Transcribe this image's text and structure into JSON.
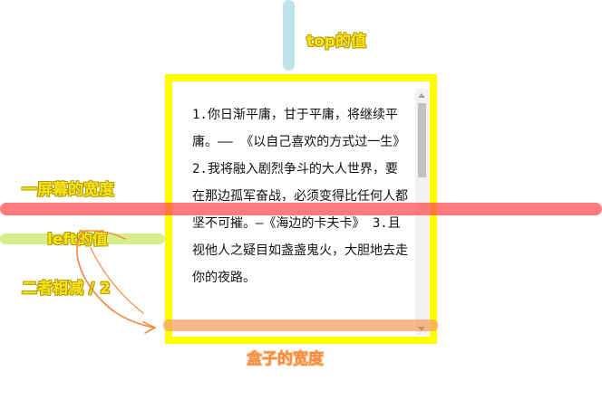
{
  "annotations": {
    "top_value": "top的值",
    "screen_width": "一屏幕的宽度",
    "left_value": "left的值",
    "difference_half": "二者相减 / 2",
    "box_width": "盒子的宽度"
  },
  "box": {
    "text": "1.你日渐平庸，甘于平庸，将继续平庸。—— 《以自己喜欢的方式过一生》 2.我将融入剧烈争斗的大人世界，要在那边孤军奋战，必须变得比任何人都坚不可摧。—《海边的卡夫卡》 3.且视他人之疑目如盏盏鬼火，大胆地去走你的夜路。"
  },
  "colors": {
    "box_border": "#ffff00",
    "top_bar": "#bfe3ea",
    "screen_bar": "#ff6b6b",
    "left_bar": "#d7ef8a",
    "box_width_bar": "#f9b48a",
    "yellow_label": "#f5e31c",
    "orange_label": "#f58a3c"
  }
}
